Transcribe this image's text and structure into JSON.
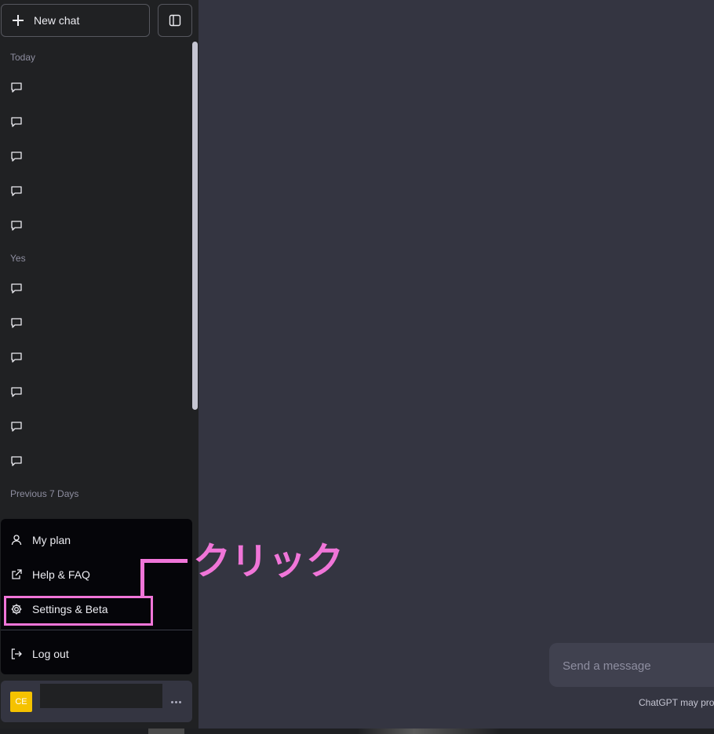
{
  "sidebar": {
    "new_chat_label": "New chat",
    "sections": [
      {
        "label": "Today",
        "chat_count": 5
      },
      {
        "label": "Yes",
        "chat_count": 6
      },
      {
        "label": "Previous 7 Days",
        "chat_count": 0
      }
    ]
  },
  "menu": {
    "items": [
      {
        "label": "My plan",
        "icon": "user-icon"
      },
      {
        "label": "Help & FAQ",
        "icon": "external-link-icon"
      },
      {
        "label": "Settings & Beta",
        "icon": "gear-icon"
      },
      {
        "label": "Log out",
        "icon": "logout-icon"
      }
    ]
  },
  "user": {
    "avatar_initials": "CE"
  },
  "annotation": {
    "text": "クリック",
    "color": "#f075d8"
  },
  "composer": {
    "placeholder": "Send a message"
  },
  "footer": {
    "note": "ChatGPT may produce"
  },
  "colors": {
    "sidebar_bg": "#202123",
    "main_bg": "#343541",
    "menu_bg": "#050509",
    "avatar_bg": "#f5c200"
  }
}
